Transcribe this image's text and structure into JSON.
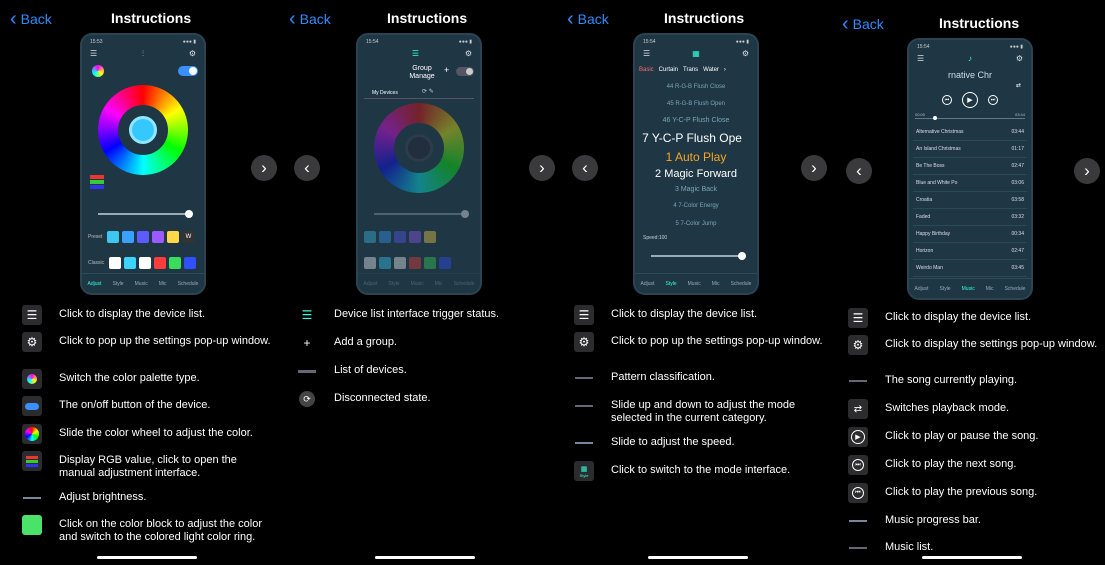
{
  "header": {
    "back_label": "Back",
    "title": "Instructions"
  },
  "panel1": {
    "phone": {
      "time": "15:53",
      "preset_label": "Preset",
      "preset_w": "W",
      "classic_label": "Classic",
      "tabs": [
        "Adjust",
        "Style",
        "Music",
        "Mic",
        "Schedule"
      ]
    },
    "items": [
      "Click to display the device list.",
      "Click to pop up the settings pop-up window.",
      "Switch the color palette type.",
      "The on/off button of the device.",
      "Slide the color wheel to adjust the color.",
      "Display RGB value, click to open the manual adjustment interface.",
      "Adjust brightness.",
      "Click on the color block to adjust the color and switch to the colored light color ring."
    ]
  },
  "panel2": {
    "phone": {
      "time": "15:54",
      "group_manage": "Group Manage",
      "plus": "+",
      "my_devices": "My Devices",
      "tabs": [
        "Adjust",
        "Style",
        "Music",
        "Mic",
        "Schedule"
      ]
    },
    "items": [
      "Device list interface trigger status.",
      "Add a group.",
      "List of devices.",
      "Disconnected state."
    ]
  },
  "panel3": {
    "phone": {
      "time": "15:54",
      "categories": [
        "Basic",
        "Curtain",
        "Trans",
        "Water"
      ],
      "patterns": [
        "44 R-G-B Flush Close",
        "45 R-G-B Flush Open",
        "46 Y-C-P Flush Close",
        "7 Y-C-P Flush Ope",
        "1 Auto Play",
        "2 Magic Forward",
        "3 Magic Back",
        "4 7-Color Energy",
        "5 7-Color Jump"
      ],
      "speed_label": "Speed:100",
      "tabs": [
        "Adjust",
        "Style",
        "Music",
        "Mic",
        "Schedule"
      ]
    },
    "items": [
      "Click to display the device list.",
      "Click to pop up the settings pop-up window.",
      "Pattern classification.",
      "Slide up and down to adjust the mode selected in the current category.",
      "Slide to adjust the speed.",
      "Click to switch to the mode interface."
    ],
    "style_icon_label": "Style"
  },
  "panel4": {
    "phone": {
      "time": "15:54",
      "now_playing": "rnative Chr",
      "time_start": "00:00",
      "time_end": "03:44",
      "songs": [
        {
          "name": "Alternative Christmas",
          "time": "03:44"
        },
        {
          "name": "An Island Christmas",
          "time": "01:17"
        },
        {
          "name": "Be The Boss",
          "time": "02:47"
        },
        {
          "name": "Blue and White Po",
          "time": "03:06"
        },
        {
          "name": "Croatia",
          "time": "03:58"
        },
        {
          "name": "Faded",
          "time": "03:32"
        },
        {
          "name": "Happy Birthday",
          "time": "00:34"
        },
        {
          "name": "Horizon",
          "time": "02:47"
        },
        {
          "name": "Weirdo Man",
          "time": "03:45"
        }
      ],
      "tabs": [
        "Adjust",
        "Style",
        "Music",
        "Mic",
        "Schedule"
      ]
    },
    "items": [
      "Click to display the device list.",
      "Click to display the settings pop-up window.",
      "The song currently playing.",
      "Switches playback mode.",
      "Click to play or pause the song.",
      "Click to play the next song.",
      "Click to play the previous song.",
      "Music progress bar.",
      "Music list."
    ]
  },
  "colors": {
    "accent": "#2f8bff",
    "phone_bg": "#1f3745",
    "selected_pattern": "#f5a623"
  }
}
